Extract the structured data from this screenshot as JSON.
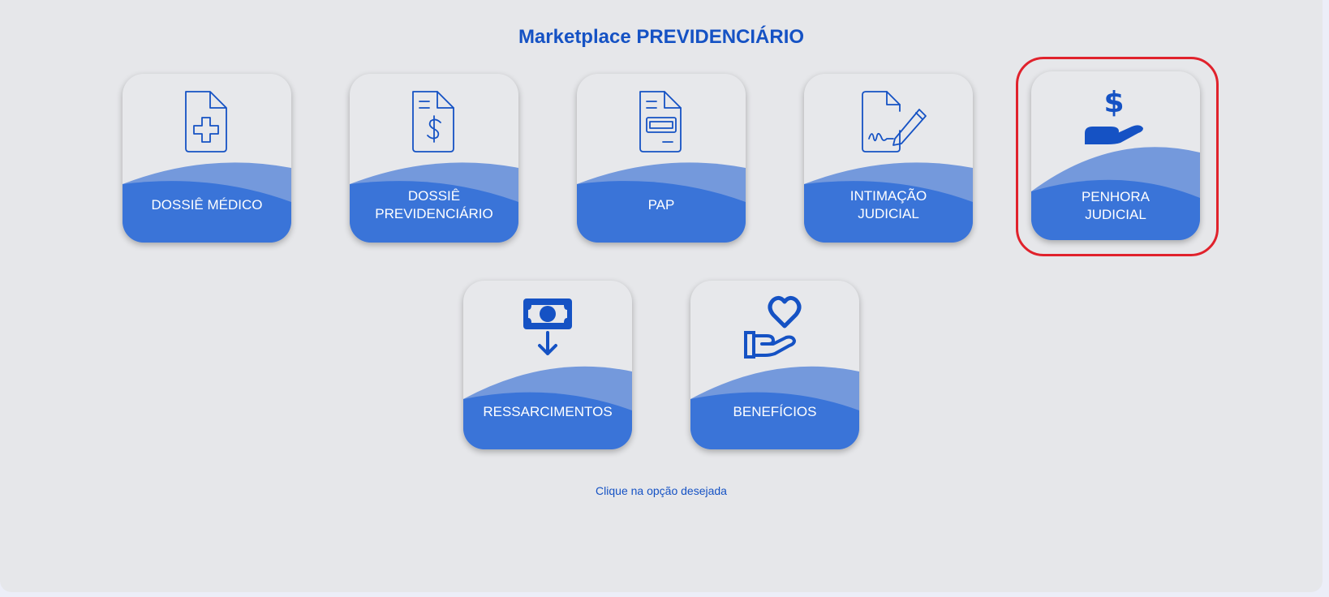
{
  "page": {
    "title": "Marketplace PREVIDENCIÁRIO",
    "hint": "Clique na opção desejada"
  },
  "cards": [
    {
      "label_lines": [
        "DOSSIÊ MÉDICO"
      ],
      "icon": "medical-document-icon"
    },
    {
      "label_lines": [
        "DOSSIÊ",
        "PREVIDENCIÁRIO"
      ],
      "icon": "dollar-document-icon"
    },
    {
      "label_lines": [
        "PAP"
      ],
      "icon": "form-document-icon"
    },
    {
      "label_lines": [
        "INTIMAÇÃO",
        "JUDICIAL"
      ],
      "icon": "signed-document-icon"
    },
    {
      "label_lines": [
        "PENHORA",
        "JUDICIAL"
      ],
      "icon": "dollar-hand-icon"
    },
    {
      "label_lines": [
        "RESSARCIMENTOS"
      ],
      "icon": "money-download-icon"
    },
    {
      "label_lines": [
        "BENEFÍCIOS"
      ],
      "icon": "heart-hand-icon"
    }
  ],
  "colors": {
    "accent": "#1552c4",
    "card_band": "#3a74d8",
    "card_band_light": "#7499dc",
    "highlight": "#e0222c"
  }
}
